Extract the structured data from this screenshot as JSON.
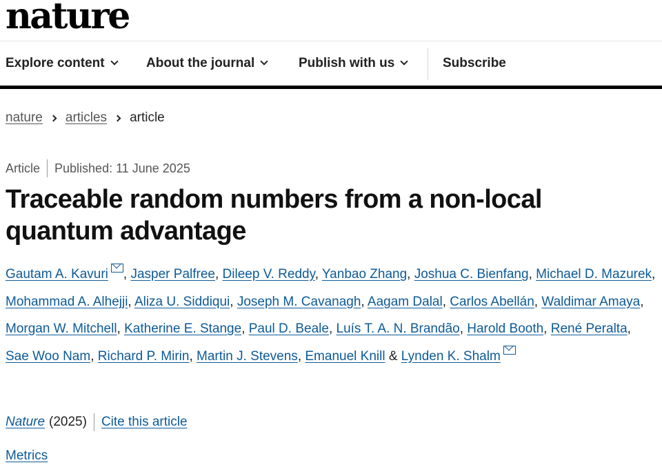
{
  "header": {
    "logo": "nature"
  },
  "nav": {
    "items": [
      {
        "label": "Explore content",
        "dropdown": true
      },
      {
        "label": "About the journal",
        "dropdown": true
      },
      {
        "label": "Publish with us",
        "dropdown": true
      },
      {
        "label": "Subscribe",
        "dropdown": false
      }
    ]
  },
  "breadcrumb": {
    "items": [
      "nature",
      "articles",
      "article"
    ]
  },
  "article": {
    "type": "Article",
    "published": "Published: 11 June 2025",
    "title": "Traceable random numbers from a non-local quantum advantage",
    "authors": [
      "Gautam A. Kavuri",
      "Jasper Palfree",
      "Dileep V. Reddy",
      "Yanbao Zhang",
      "Joshua C. Bienfang",
      "Michael D. Mazurek",
      "Mohammad A. Alhejji",
      "Aliza U. Siddiqui",
      "Joseph M. Cavanagh",
      "Aagam Dalal",
      "Carlos Abellán",
      "Waldimar Amaya",
      "Morgan W. Mitchell",
      "Katherine E. Stange",
      "Paul D. Beale",
      "Luís T. A. N. Brandão",
      "Harold Booth",
      "René Peralta",
      "Sae Woo Nam",
      "Richard P. Mirin",
      "Martin J. Stevens",
      "Emanuel Knill",
      "Lynden K. Shalm"
    ],
    "journal": "Nature",
    "year": "(2025)",
    "cite_label": "Cite this article",
    "metrics_label": "Metrics"
  },
  "colors": {
    "link": "#0c5a98",
    "text": "#222222",
    "rule": "#000000"
  }
}
